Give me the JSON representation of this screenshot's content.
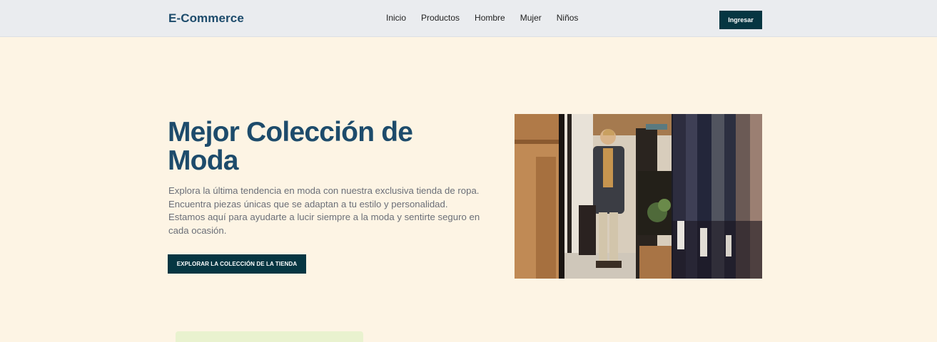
{
  "header": {
    "brand": "E-Commerce",
    "nav": [
      "Inicio",
      "Productos",
      "Hombre",
      "Mujer",
      "Niños"
    ],
    "login_label": "Ingresar"
  },
  "hero": {
    "title": "Mejor Colección de Moda",
    "description": "Explora la última tendencia en moda con nuestra exclusiva tienda de ropa. Encuentra piezas únicas que se adaptan a tu estilo y personalidad. Estamos aquí para ayudarte a lucir siempre a la moda y sentirte seguro en cada ocasión.",
    "cta_label": "EXPLORAR LA COLECCIÓN DE LA TIENDA"
  },
  "colors": {
    "brand": "#1d4b6b",
    "button": "#063642",
    "page_bg": "#fdf4e4",
    "header_bg": "#eaecef"
  }
}
